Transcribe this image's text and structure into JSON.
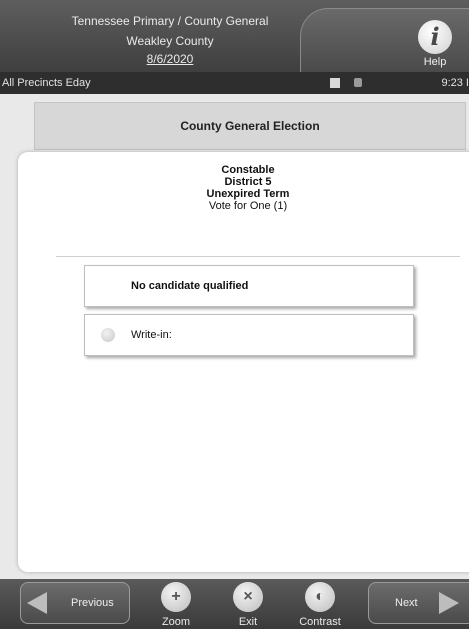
{
  "header": {
    "line1": "Tennessee Primary / County General",
    "line2": "Weakley County",
    "date": "8/6/2020",
    "help_label": "Help",
    "help_glyph": "i"
  },
  "status_bar": {
    "precinct": "All Precincts Eday",
    "time": "9:23 I"
  },
  "election_title": "County General Election",
  "contest": {
    "office": "Constable",
    "district": "District 5",
    "term": "Unexpired Term",
    "instruction": "Vote for One (1)"
  },
  "choices": [
    {
      "label": "No candidate qualified"
    },
    {
      "label": "Write-in:"
    }
  ],
  "footer": {
    "previous_label": "Previous",
    "next_label": "Next",
    "zoom_label": "Zoom",
    "exit_label": "Exit",
    "contrast_label": "Contrast"
  }
}
